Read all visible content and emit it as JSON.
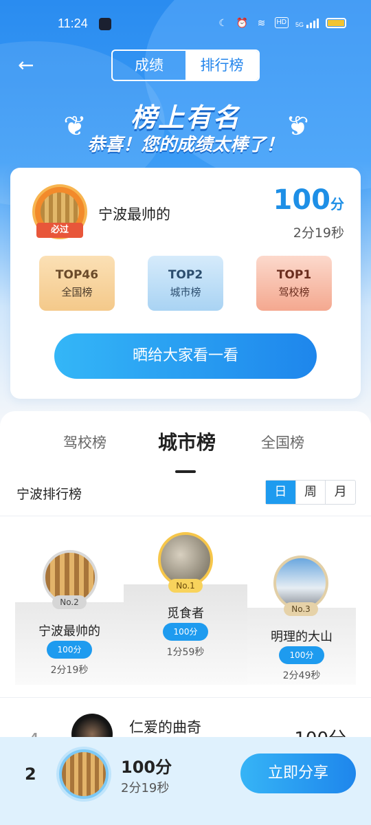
{
  "status_bar": {
    "time": "11:24",
    "hd": "HD",
    "net": "5G"
  },
  "nav": {
    "back_icon": "arrow-left-icon",
    "tabs": [
      {
        "label": "成绩",
        "active": false
      },
      {
        "label": "排行榜",
        "active": true
      }
    ]
  },
  "banner": {
    "title": "榜上有名",
    "subtitle": "恭喜！您的成绩太棒了！"
  },
  "result_card": {
    "badge_text": "必过",
    "username": "宁波最帅的",
    "score": "100",
    "score_unit": "分",
    "time": "2分19秒",
    "ranks": [
      {
        "top": "TOP46",
        "label": "全国榜"
      },
      {
        "top": "TOP2",
        "label": "城市榜"
      },
      {
        "top": "TOP1",
        "label": "驾校榜"
      }
    ],
    "share_label": "晒给大家看一看"
  },
  "leaderboard": {
    "tabs": [
      {
        "label": "驾校榜"
      },
      {
        "label": "城市榜"
      },
      {
        "label": "全国榜"
      }
    ],
    "title": "宁波排行榜",
    "periods": [
      "日",
      "周",
      "月"
    ],
    "podium": [
      {
        "rank": "No.2",
        "name": "宁波最帅的",
        "score": "100分",
        "time": "2分19秒"
      },
      {
        "rank": "No.1",
        "name": "觅食者",
        "score": "100分",
        "time": "1分59秒"
      },
      {
        "rank": "No.3",
        "name": "明理的大山",
        "score": "100分",
        "time": "2分49秒"
      }
    ],
    "list": [
      {
        "rank": "4",
        "name": "仁爱的曲奇",
        "score": "100分"
      }
    ]
  },
  "my_bar": {
    "rank": "2",
    "score": "100分",
    "time": "2分19秒",
    "share_label": "立即分享"
  },
  "colors": {
    "primary": "#1e9bef",
    "brand_blue": "#2a8cf0",
    "gold": "#f4c98a"
  }
}
